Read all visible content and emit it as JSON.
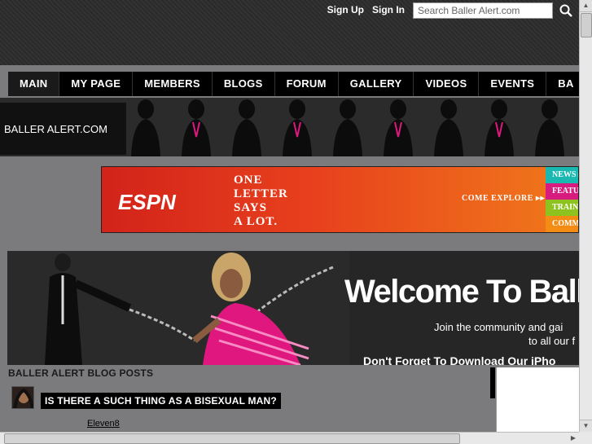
{
  "header": {
    "sign_up": "Sign Up",
    "sign_in": "Sign In",
    "search_placeholder": "Search Baller Alert.com",
    "search_icon": "search-icon"
  },
  "nav": {
    "items": [
      "MAIN",
      "MY PAGE",
      "MEMBERS",
      "BLOGS",
      "FORUM",
      "GALLERY",
      "VIDEOS",
      "EVENTS",
      "BA"
    ],
    "active_index": 0
  },
  "banner": {
    "brand": "BALLER ALERT.COM"
  },
  "ad": {
    "logo": "ESPN",
    "tagline_lines": [
      "ONE",
      "LETTER",
      "SAYS",
      "A LOT."
    ],
    "cta": "COME EXPLORE ▸▸",
    "tabs": [
      {
        "label": "NEWS ▸▸",
        "color": "#19b8b0"
      },
      {
        "label": "FEATU",
        "color": "#d81b7f"
      },
      {
        "label": "TRAIN",
        "color": "#8dc21f"
      },
      {
        "label": "COMM",
        "color": "#f28c14"
      }
    ]
  },
  "hero": {
    "title": "Welcome To Balle",
    "sub1": "Join the community and gai",
    "sub2": "to all our f",
    "sub3": "Don't Forget To Download Our iPho"
  },
  "blog": {
    "section_title": "BALLER ALERT BLOG POSTS",
    "post_title": "IS THERE A SUCH THING AS A BISEXUAL MAN?",
    "post_author": "Eleven8"
  },
  "colors": {
    "page_bg": "#7b7a7d",
    "nav_bg": "#000000",
    "accent_pink": "#e0177f"
  }
}
